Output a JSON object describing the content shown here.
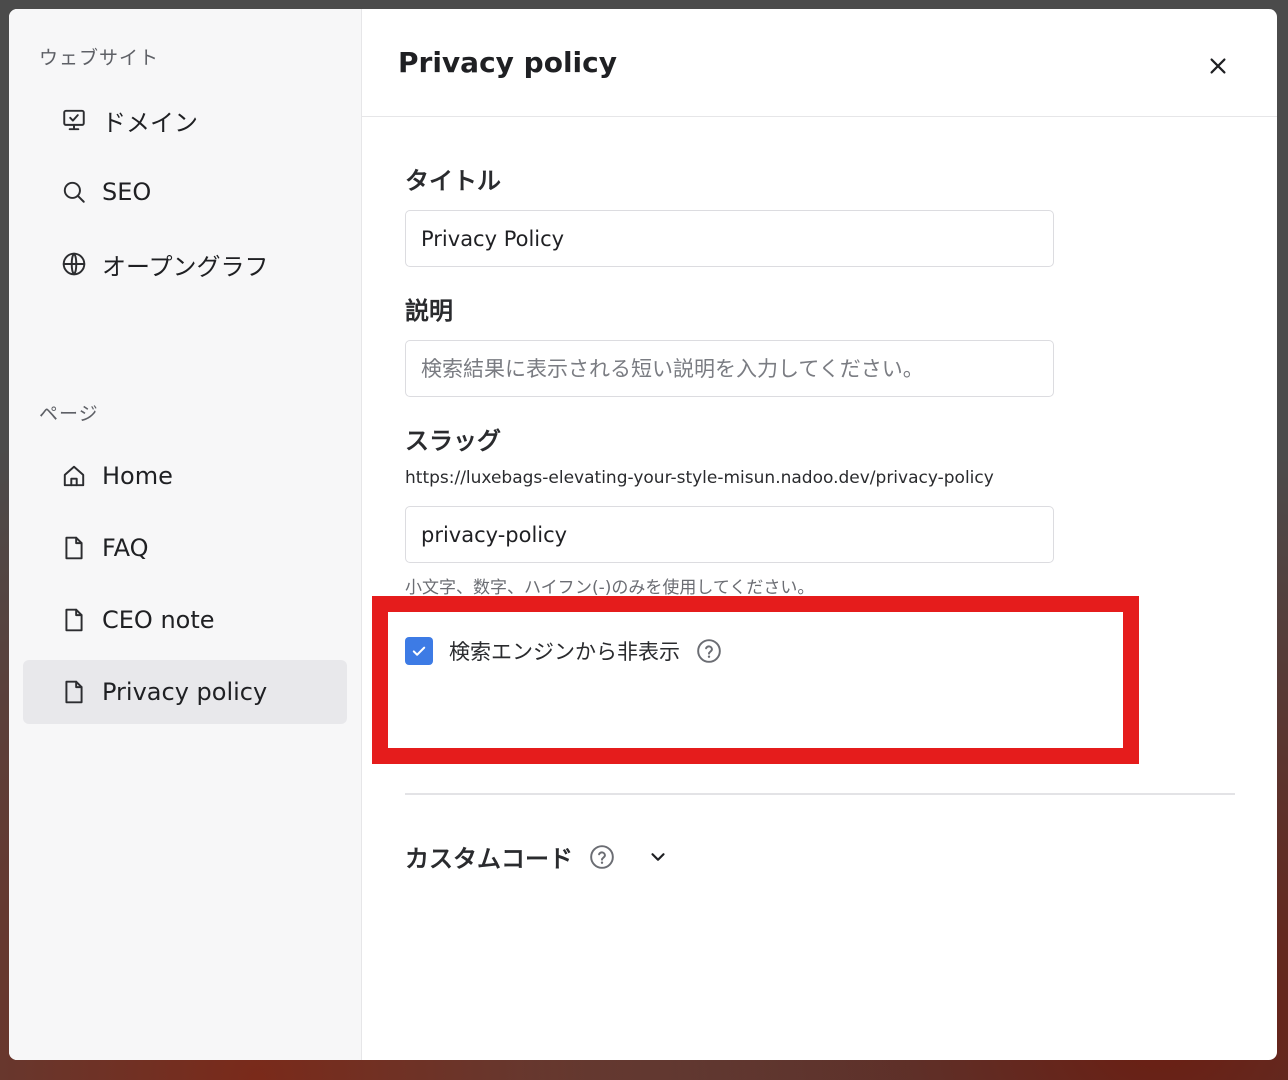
{
  "sidebar": {
    "website_section": "ウェブサイト",
    "website_items": [
      {
        "label": "ドメイン",
        "icon": "monitor-icon"
      },
      {
        "label": "SEO",
        "icon": "search-icon"
      },
      {
        "label": "オープングラフ",
        "icon": "globe-icon"
      }
    ],
    "pages_section": "ページ",
    "page_items": [
      {
        "label": "Home",
        "icon": "home-icon"
      },
      {
        "label": "FAQ",
        "icon": "file-icon"
      },
      {
        "label": "CEO note",
        "icon": "file-icon"
      },
      {
        "label": "Privacy policy",
        "icon": "file-icon",
        "active": true
      }
    ]
  },
  "header": {
    "title": "Privacy policy"
  },
  "form": {
    "title_label": "タイトル",
    "title_value": "Privacy Policy",
    "description_label": "説明",
    "description_placeholder": "検索結果に表示される短い説明を入力してください。",
    "slug_label": "スラッグ",
    "slug_url": "https://luxebags-elevating-your-style-misun.nadoo.dev/privacy-policy",
    "slug_value": "privacy-policy",
    "slug_hint": "小文字、数字、ハイフン(-)のみを使用してください。",
    "hide_from_search_label": "検索エンジンから非表示",
    "hide_from_search_checked": true,
    "custom_code_label": "カスタムコード"
  },
  "colors": {
    "accent": "#3d7be5",
    "highlight": "#e51c1c",
    "sidebar_bg": "#f7f7f8",
    "active_item_bg": "#e8e8eb"
  }
}
